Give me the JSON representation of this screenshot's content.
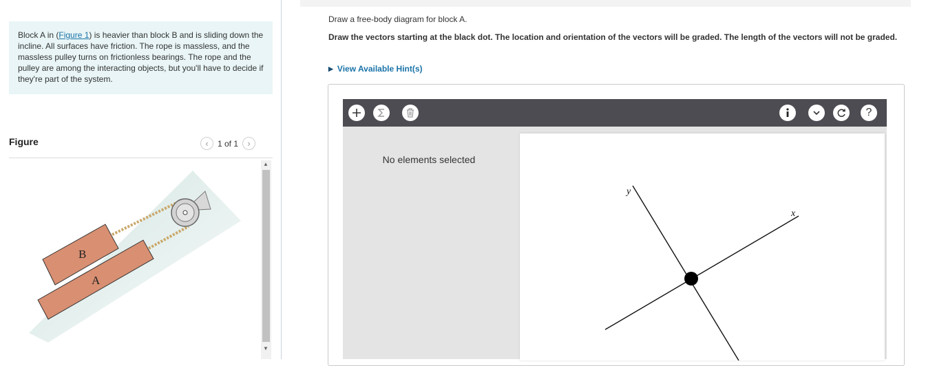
{
  "problem": {
    "text_before": "Block A in (",
    "link": "Figure 1",
    "text_after": ") is heavier than block B and is sliding down the incline. All surfaces have friction. The rope is massless, and the massless pulley turns on frictionless bearings. The rope and the pulley are among the interacting objects, but you'll have to decide if they're part of the system."
  },
  "figure": {
    "label": "Figure",
    "pager": "1 of 1",
    "prev_icon": "chevron-left-icon",
    "next_icon": "chevron-right-icon",
    "block_b_label": "B",
    "block_a_label": "A",
    "block_color": "#d98f72"
  },
  "instructions": {
    "line1": "Draw a free-body diagram for block A.",
    "line2": "Draw the vectors starting at the black dot. The location and orientation of the vectors will be graded. The length of the vectors will not be graded.",
    "hint": "View Available Hint(s)"
  },
  "tool": {
    "left_buttons": [
      "plus-icon",
      "sigma-icon",
      "trash-icon"
    ],
    "right_buttons": [
      "info-icon",
      "chevron-down-icon",
      "reset-icon",
      "help-icon"
    ],
    "no_selection": "No elements selected",
    "axis_x": "x",
    "axis_y": "y",
    "toolbar_color": "#4c4c52"
  }
}
